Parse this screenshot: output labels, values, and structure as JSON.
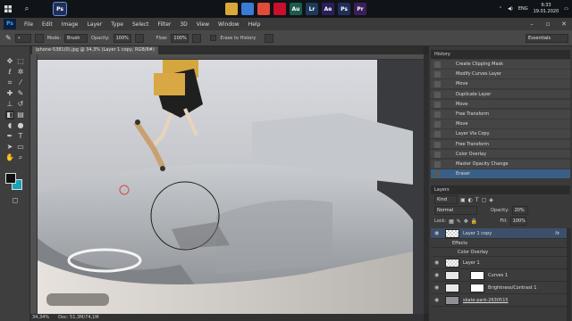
{
  "taskbar": {
    "tray_lang": "ENG",
    "time": "9:33",
    "date": "19.01.2020",
    "apps": [
      {
        "name": "ps",
        "label": "Ps",
        "color": "#1f2f5a"
      },
      {
        "name": "folder",
        "label": "",
        "color": "#d8a83a"
      },
      {
        "name": "explorer",
        "label": "",
        "color": "#3a7bd5"
      },
      {
        "name": "chrome",
        "label": "",
        "color": "#e04b3a"
      },
      {
        "name": "opera",
        "label": "",
        "color": "#c8102e"
      },
      {
        "name": "audition",
        "label": "Au",
        "color": "#1e5a4f"
      },
      {
        "name": "lightroom",
        "label": "Lr",
        "color": "#1d3a5a"
      },
      {
        "name": "aftereffects",
        "label": "Ae",
        "color": "#2a1f5a"
      },
      {
        "name": "ps2",
        "label": "Ps",
        "color": "#1f2f5a"
      },
      {
        "name": "premiere",
        "label": "Pr",
        "color": "#3a1f5a"
      }
    ]
  },
  "menu": {
    "logo": "Ps",
    "items": [
      "File",
      "Edit",
      "Image",
      "Layer",
      "Type",
      "Select",
      "Filter",
      "3D",
      "View",
      "Window",
      "Help"
    ]
  },
  "options": {
    "mode_label": "Mode:",
    "mode_value": "Brush",
    "opacity_label": "Opacity:",
    "opacity_value": "100%",
    "flow_label": "Flow:",
    "flow_value": "100%",
    "erase_history": "Erase to History",
    "workspace": "Essentials"
  },
  "document": {
    "tab_title": "iphone-5381(0).jpg @ 34,3% (Layer 1 copy, RGB/8#)",
    "zoom": "34,34%",
    "doc_size": "Doc: 51,3M/74,1M"
  },
  "history": {
    "title": "History",
    "items": [
      "Create Clipping Mask",
      "Modify Curves Layer",
      "Move",
      "Duplicate Layer",
      "Move",
      "Free Transform",
      "Move",
      "Layer Via Copy",
      "Free Transform",
      "Color Overlay",
      "Master Opacity Change",
      "Eraser"
    ]
  },
  "layers": {
    "title": "Layers",
    "filter": "Kind",
    "blend": "Normal",
    "opacity_label": "Opacity:",
    "opacity_value": "20%",
    "lock_label": "Lock:",
    "fill_label": "Fill:",
    "fill_value": "100%",
    "rows": [
      {
        "name": "Layer 1 copy",
        "fx": "fx"
      },
      {
        "name": "Effects",
        "fx": ""
      },
      {
        "name": "Color Overlay",
        "fx": ""
      },
      {
        "name": "Layer 1",
        "fx": ""
      },
      {
        "name": "Curves 1",
        "fx": ""
      },
      {
        "name": "Brightness/Contrast 1",
        "fx": ""
      },
      {
        "name": "skate-park-2630515",
        "fx": ""
      }
    ]
  },
  "colors": {
    "foreground": "#111111",
    "background": "#17a3b8",
    "history_selected": "#3a5f86",
    "layer_selected": "#3d4f6a"
  }
}
